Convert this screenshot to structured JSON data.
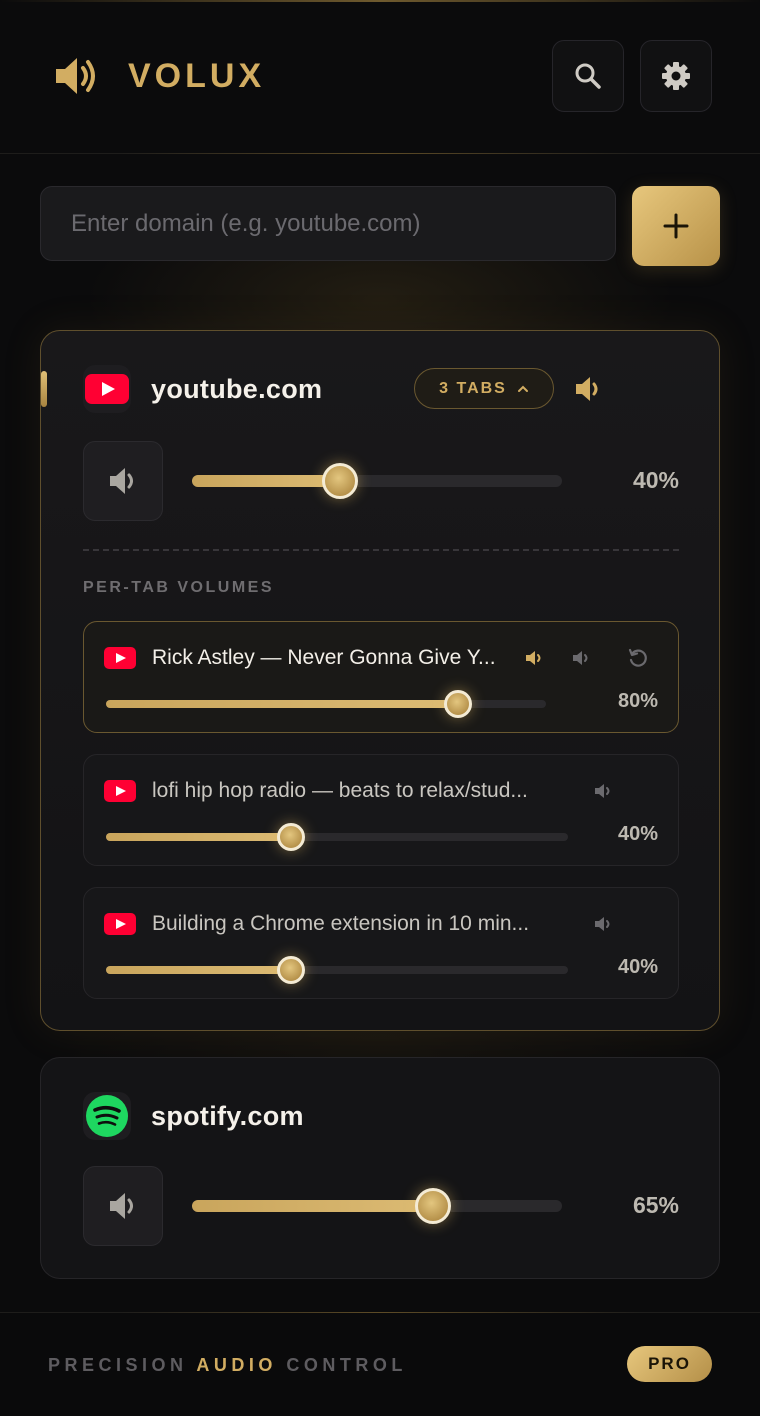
{
  "app": {
    "brand": "VOLUX",
    "accent_color": "#d2ad62"
  },
  "header": {
    "search_icon": "search-icon",
    "settings_icon": "gear-icon"
  },
  "domain_input": {
    "placeholder": "Enter domain (e.g. youtube.com)",
    "value": "",
    "add_icon": "plus-icon"
  },
  "domains": [
    {
      "name": "youtube.com",
      "icon": "youtube-icon",
      "tabs_label": "3 TABS",
      "expanded": true,
      "volume": 40,
      "volume_label": "40%",
      "section_label": "PER-TAB VOLUMES",
      "tabs": [
        {
          "title": "Rick Astley — Never Gonna Give Y...",
          "volume": 80,
          "volume_label": "80%",
          "playing": true
        },
        {
          "title": "lofi hip hop radio — beats to relax/stud...",
          "volume": 40,
          "volume_label": "40%",
          "playing": false
        },
        {
          "title": "Building a Chrome extension in 10 min...",
          "volume": 40,
          "volume_label": "40%",
          "playing": false
        }
      ]
    },
    {
      "name": "spotify.com",
      "icon": "spotify-icon",
      "volume": 65,
      "volume_label": "65%"
    }
  ],
  "footer": {
    "tagline_pre": "PRECISION ",
    "tagline_accent": "AUDIO",
    "tagline_post": " CONTROL",
    "badge": "PRO"
  }
}
